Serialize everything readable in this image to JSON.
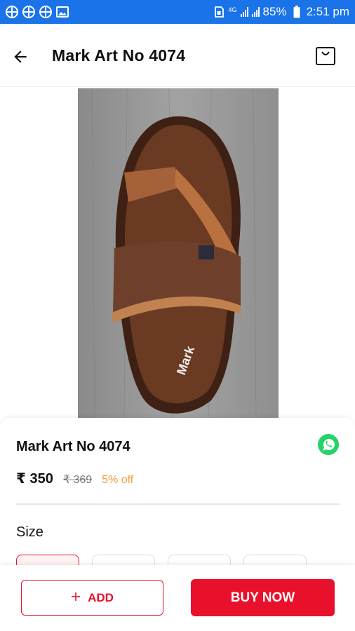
{
  "status_bar": {
    "battery": "85%",
    "time": "2:51 pm",
    "network": "4G",
    "icons": [
      "app-grid-icon",
      "app-grid-icon",
      "app-grid-icon",
      "image-icon",
      "sim-icon",
      "signal-icon",
      "signal-icon",
      "battery-icon"
    ]
  },
  "header": {
    "title": "Mark Art No 4074",
    "back_icon": "arrow-left-icon",
    "cart_icon": "shopping-bag-icon"
  },
  "product": {
    "name": "Mark Art No 4074",
    "price": "₹ 350",
    "mrp": "₹ 369",
    "discount": "5% off",
    "share_icon": "whatsapp-icon",
    "size_label": "Size"
  },
  "actions": {
    "add_label": "ADD",
    "add_icon": "plus-icon",
    "buy_label": "BUY NOW"
  },
  "colors": {
    "status_bar": "#1a73e8",
    "accent": "#e8102a",
    "discount": "#f39c3c",
    "whatsapp": "#25d366"
  }
}
